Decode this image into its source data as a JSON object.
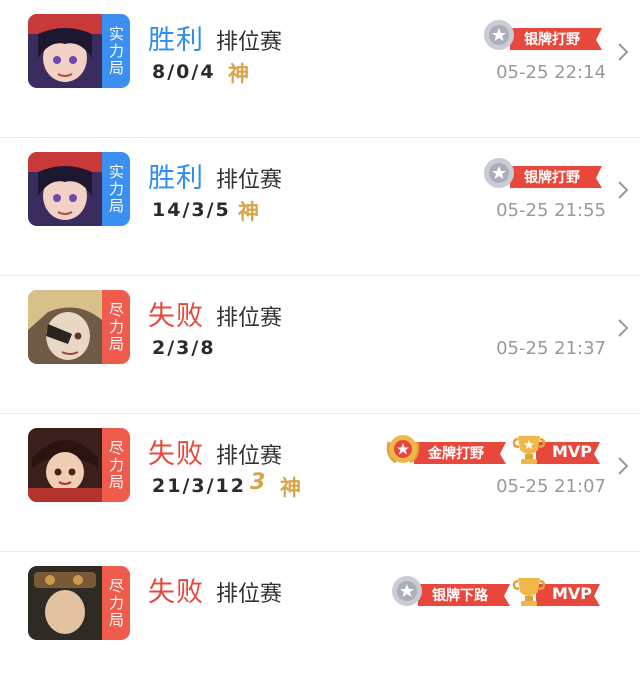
{
  "matches": [
    {
      "mode": "实力局",
      "result": "胜利",
      "match_type": "排位赛",
      "kda": "8/0/4",
      "tag": "神",
      "badge_text": "银牌打野",
      "time": "05-25 22:14"
    },
    {
      "mode": "实力局",
      "result": "胜利",
      "match_type": "排位赛",
      "kda": "14/3/5",
      "tag": "神",
      "badge_text": "银牌打野",
      "time": "05-25 21:55"
    },
    {
      "mode": "尽力局",
      "result": "失败",
      "match_type": "排位赛",
      "kda": "2/3/8",
      "time": "05-25 21:37"
    },
    {
      "mode": "尽力局",
      "result": "失败",
      "match_type": "排位赛",
      "kda": "21/3/12",
      "tag_number": "3",
      "tag": "神",
      "badge_text": "金牌打野",
      "mvp_text": "MVP",
      "time": "05-25 21:07"
    },
    {
      "mode": "尽力局",
      "result": "失败",
      "match_type": "排位赛",
      "badge_text": "银牌下路",
      "mvp_text": "MVP"
    }
  ],
  "colors": {
    "win": "#2f8ef2",
    "lose": "#e8483b",
    "mode_blue": "#3a8ff0",
    "mode_red": "#ef5b4d",
    "gold": "#d9a34a",
    "badge_red": "#e8483b"
  },
  "icons": [
    "silver-medal-icon",
    "gold-medal-icon",
    "mvp-trophy-icon",
    "chevron-right-icon"
  ]
}
